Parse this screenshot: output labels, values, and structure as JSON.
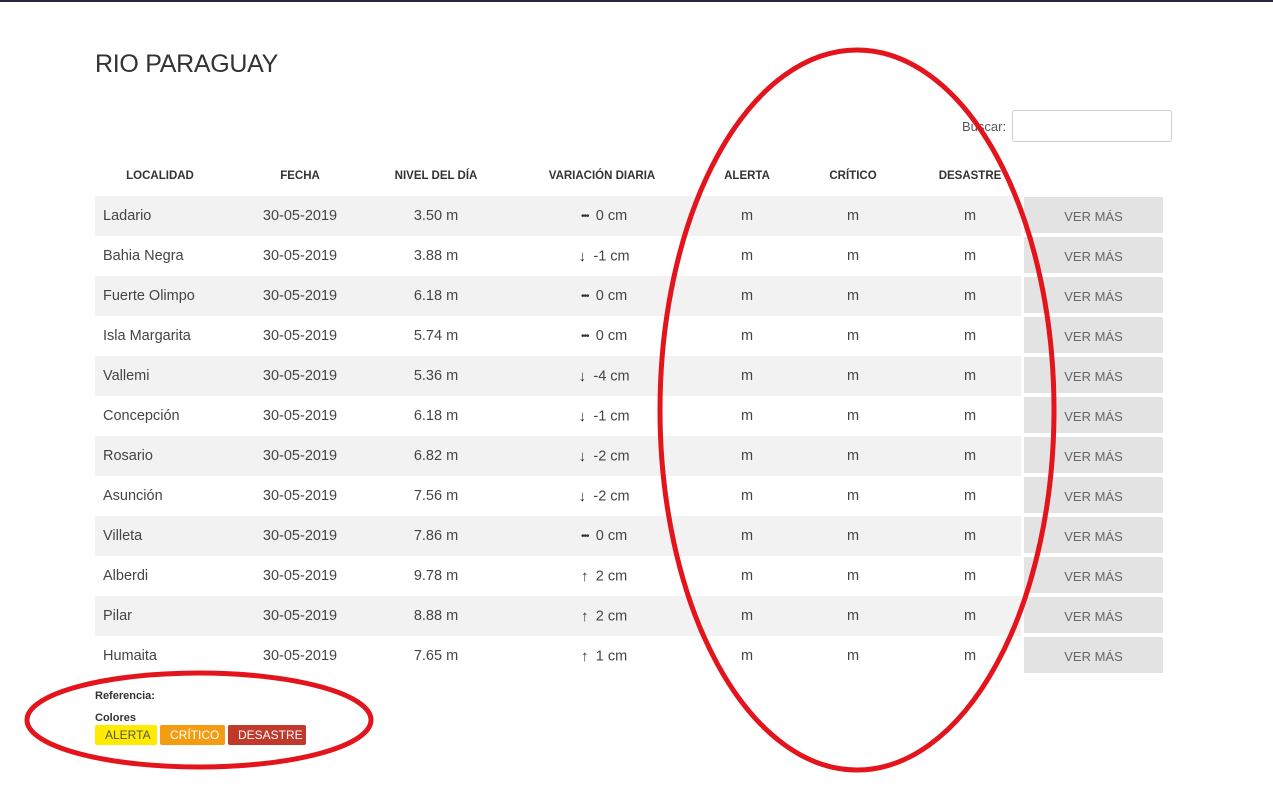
{
  "page": {
    "title": "RIO PARAGUAY"
  },
  "search": {
    "label": "Buscar:",
    "placeholder": ""
  },
  "table": {
    "headers": [
      "LOCALIDAD",
      "FECHA",
      "NIVEL DEL DÍA",
      "VARIACIÓN DIARIA",
      "ALERTA",
      "CRÍTICO",
      "DESASTRE",
      ""
    ],
    "button_label": "VER MÁS",
    "rows": [
      {
        "localidad": "Ladario",
        "fecha": "30-05-2019",
        "nivel": "3.50 m",
        "var_icon": "ellipsis-icon",
        "variacion": "0 cm",
        "alerta": "m",
        "critico": "m",
        "desastre": "m"
      },
      {
        "localidad": "Bahia Negra",
        "fecha": "30-05-2019",
        "nivel": "3.88 m",
        "var_icon": "arrow-down-icon",
        "variacion": "-1 cm",
        "alerta": "m",
        "critico": "m",
        "desastre": "m"
      },
      {
        "localidad": "Fuerte Olimpo",
        "fecha": "30-05-2019",
        "nivel": "6.18 m",
        "var_icon": "ellipsis-icon",
        "variacion": "0 cm",
        "alerta": "m",
        "critico": "m",
        "desastre": "m"
      },
      {
        "localidad": "Isla Margarita",
        "fecha": "30-05-2019",
        "nivel": "5.74 m",
        "var_icon": "ellipsis-icon",
        "variacion": "0 cm",
        "alerta": "m",
        "critico": "m",
        "desastre": "m"
      },
      {
        "localidad": "Vallemi",
        "fecha": "30-05-2019",
        "nivel": "5.36 m",
        "var_icon": "arrow-down-icon",
        "variacion": "-4 cm",
        "alerta": "m",
        "critico": "m",
        "desastre": "m"
      },
      {
        "localidad": "Concepción",
        "fecha": "30-05-2019",
        "nivel": "6.18 m",
        "var_icon": "arrow-down-icon",
        "variacion": "-1 cm",
        "alerta": "m",
        "critico": "m",
        "desastre": "m"
      },
      {
        "localidad": "Rosario",
        "fecha": "30-05-2019",
        "nivel": "6.82 m",
        "var_icon": "arrow-down-icon",
        "variacion": "-2 cm",
        "alerta": "m",
        "critico": "m",
        "desastre": "m"
      },
      {
        "localidad": "Asunción",
        "fecha": "30-05-2019",
        "nivel": "7.56 m",
        "var_icon": "arrow-down-icon",
        "variacion": "-2 cm",
        "alerta": "m",
        "critico": "m",
        "desastre": "m"
      },
      {
        "localidad": "Villeta",
        "fecha": "30-05-2019",
        "nivel": "7.86 m",
        "var_icon": "ellipsis-icon",
        "variacion": "0 cm",
        "alerta": "m",
        "critico": "m",
        "desastre": "m"
      },
      {
        "localidad": "Alberdi",
        "fecha": "30-05-2019",
        "nivel": "9.78 m",
        "var_icon": "arrow-up-icon",
        "variacion": "2 cm",
        "alerta": "m",
        "critico": "m",
        "desastre": "m"
      },
      {
        "localidad": "Pilar",
        "fecha": "30-05-2019",
        "nivel": "8.88 m",
        "var_icon": "arrow-up-icon",
        "variacion": "2 cm",
        "alerta": "m",
        "critico": "m",
        "desastre": "m"
      },
      {
        "localidad": "Humaita",
        "fecha": "30-05-2019",
        "nivel": "7.65 m",
        "var_icon": "arrow-up-icon",
        "variacion": "1 cm",
        "alerta": "m",
        "critico": "m",
        "desastre": "m"
      }
    ]
  },
  "reference": {
    "title": "Referencia:",
    "subtitle": "Colores",
    "badges": [
      {
        "label": "ALERTA",
        "color": "#ffea00"
      },
      {
        "label": "CRÍTICO",
        "color": "#f39c12"
      },
      {
        "label": "DESASTRE",
        "color": "#c0392b"
      }
    ]
  },
  "annotation": {
    "color": "#e3141c"
  }
}
